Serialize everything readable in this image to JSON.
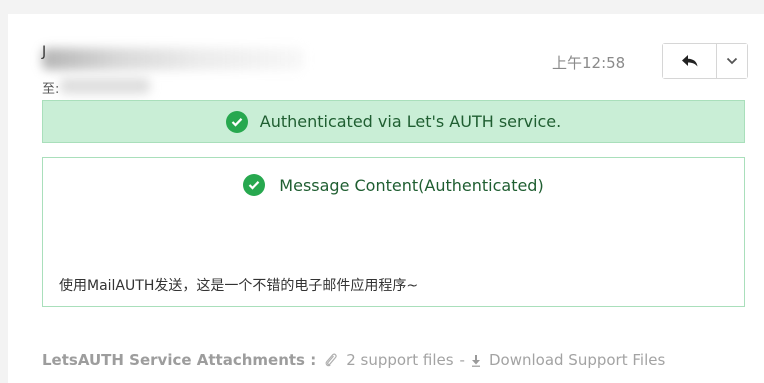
{
  "header": {
    "sender_initial": "J",
    "to_prefix": "至: ",
    "time": "上午12:58"
  },
  "actions": {
    "reply_icon": "reply-arrow-icon",
    "more_icon": "chevron-down-icon"
  },
  "auth_banner": {
    "icon": "check-circle-icon",
    "text": "Authenticated via Let's AUTH service.",
    "background": "#c9eed6",
    "accent": "#27a84f"
  },
  "message": {
    "title_icon": "check-circle-icon",
    "title": "Message Content(Authenticated)",
    "body": "使用MailAUTH发送，这是一个不错的电子邮件应用程序~"
  },
  "attachments": {
    "label": "LetsAUTH Service Attachments :",
    "clip_icon": "paperclip-icon",
    "count_text": "2 support files",
    "separator": "-",
    "download_icon": "download-arrow-icon",
    "download_text": "Download Support Files"
  }
}
